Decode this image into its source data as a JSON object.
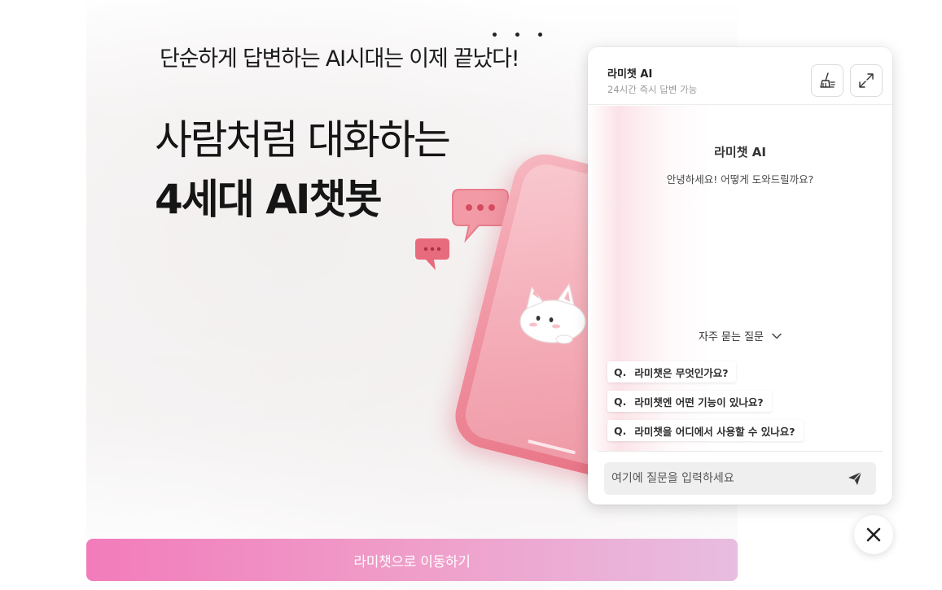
{
  "promo": {
    "tagline": "단순하게 답변하는 AI시대는 이제 끝났다!",
    "headline_line1": "사람처럼 대화하는",
    "headline_line2": "4세대 AI챗봇"
  },
  "chat": {
    "title": "라미챗 AI",
    "subtitle": "24시간 즉시 답변 가능",
    "clear_icon": "broom-icon",
    "expand_icon": "expand-icon",
    "bot_name": "라미챗 AI",
    "greeting": "안녕하세요! 어떻게 도와드릴까요?",
    "faq_label": "자주 묻는 질문",
    "faq": [
      {
        "prefix": "Q.",
        "text": "라미챗은 무엇인가요?"
      },
      {
        "prefix": "Q.",
        "text": "라미챗엔 어떤 기능이 있나요?"
      },
      {
        "prefix": "Q.",
        "text": "라미챗을 어디에서 사용할 수 있나요?"
      }
    ],
    "input_placeholder": "여기에 질문을 입력하세요",
    "send_icon": "paper-plane-icon"
  },
  "close_icon": "close-icon",
  "cta_label": "라미챗으로 이동하기",
  "colors": {
    "cta_start": "#f27cbb",
    "cta_end": "#e8bde0",
    "phone": "#ef8d9c"
  }
}
